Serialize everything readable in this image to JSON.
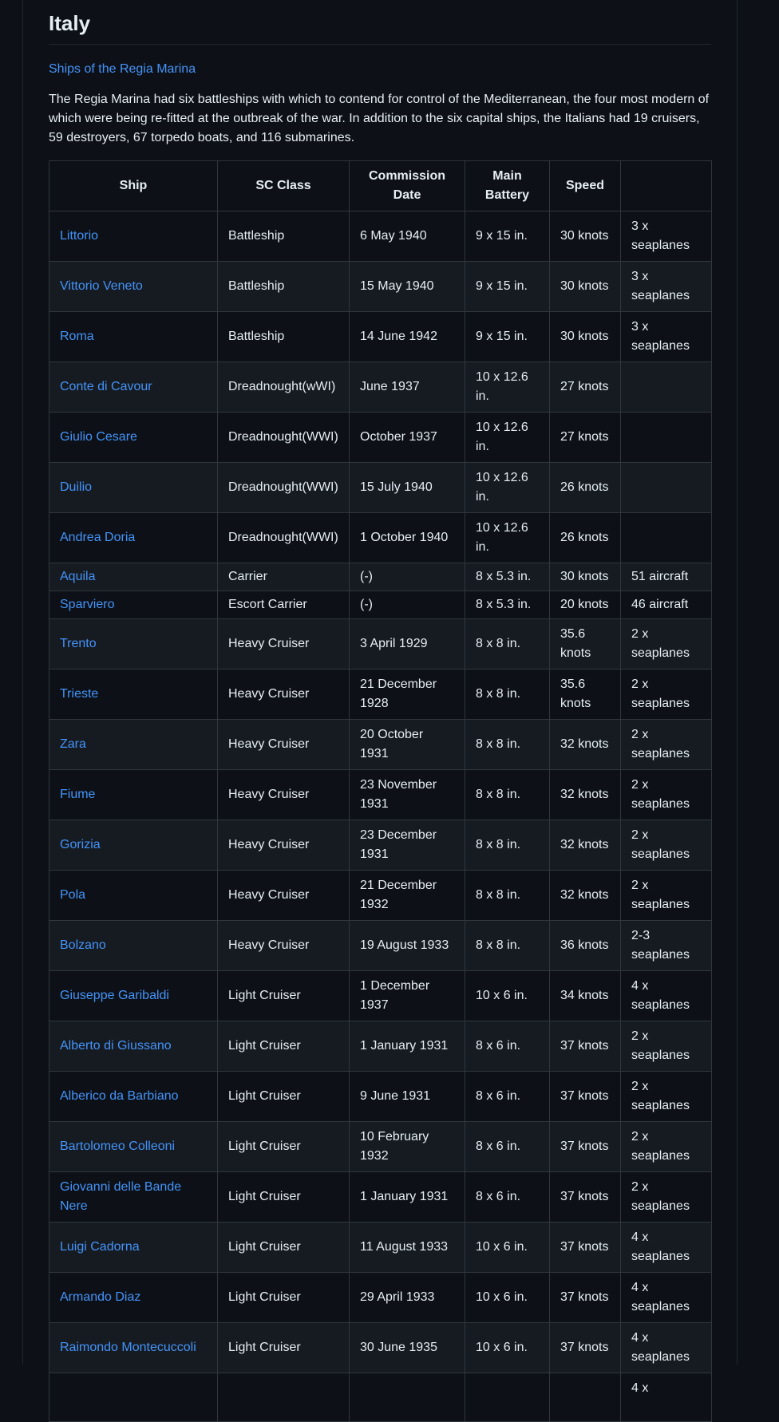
{
  "section_title": "Italy",
  "subheading_link": "Ships of the Regia Marina",
  "intro": "The Regia Marina had six battleships with which to contend for control of the Mediterranean, the four most modern of which were being re-fitted at the outbreak of the war. In addition to the six capital ships, the Italians had 19 cruisers, 59 destroyers, 67 torpedo boats, and 116 submarines.",
  "table": {
    "headers": [
      "Ship",
      "SC Class",
      "Commission Date",
      "Main Battery",
      "Speed",
      ""
    ],
    "rows": [
      [
        "Littorio",
        "Battleship",
        "6 May 1940",
        "9 x 15 in.",
        "30 knots",
        "3 x seaplanes"
      ],
      [
        "Vittorio Veneto",
        "Battleship",
        "15 May 1940",
        "9 x 15 in.",
        "30 knots",
        "3 x seaplanes"
      ],
      [
        "Roma",
        "Battleship",
        "14 June 1942",
        "9 x 15 in.",
        "30 knots",
        "3 x seaplanes"
      ],
      [
        "Conte di Cavour",
        "Dreadnought(wWI)",
        "June 1937",
        "10 x 12.6 in.",
        "27 knots",
        ""
      ],
      [
        "Giulio Cesare",
        "Dreadnought(WWI)",
        "October 1937",
        "10 x 12.6 in.",
        "27 knots",
        ""
      ],
      [
        "Duilio",
        "Dreadnought(WWI)",
        "15 July 1940",
        "10 x 12.6 in.",
        "26 knots",
        ""
      ],
      [
        "Andrea Doria",
        "Dreadnought(WWI)",
        "1 October 1940",
        "10 x 12.6 in.",
        "26 knots",
        ""
      ],
      [
        "Aquila",
        "Carrier",
        "(-)",
        "8 x 5.3 in.",
        "30 knots",
        "51 aircraft"
      ],
      [
        "Sparviero",
        "Escort Carrier",
        "(-)",
        "8 x 5.3 in.",
        "20 knots",
        "46 aircraft"
      ],
      [
        "Trento",
        "Heavy Cruiser",
        "3 April 1929",
        "8 x 8 in.",
        "35.6 knots",
        "2 x seaplanes"
      ],
      [
        "Trieste",
        "Heavy Cruiser",
        "21 December 1928",
        "8 x 8 in.",
        "35.6 knots",
        "2 x seaplanes"
      ],
      [
        "Zara",
        "Heavy Cruiser",
        "20 October 1931",
        "8 x 8 in.",
        "32 knots",
        "2 x seaplanes"
      ],
      [
        "Fiume",
        "Heavy Cruiser",
        "23 November 1931",
        "8 x 8 in.",
        "32 knots",
        "2 x seaplanes"
      ],
      [
        "Gorizia",
        "Heavy Cruiser",
        "23 December 1931",
        "8 x 8 in.",
        "32 knots",
        "2 x seaplanes"
      ],
      [
        "Pola",
        "Heavy Cruiser",
        "21 December 1932",
        "8 x 8 in.",
        "32 knots",
        "2 x seaplanes"
      ],
      [
        "Bolzano",
        "Heavy Cruiser",
        "19 August 1933",
        "8 x 8 in.",
        "36 knots",
        "2-3 seaplanes"
      ],
      [
        "Giuseppe Garibaldi",
        "Light Cruiser",
        "1 December 1937",
        "10 x 6 in.",
        "34 knots",
        "4 x seaplanes"
      ],
      [
        "Alberto di Giussano",
        "Light Cruiser",
        "1 January 1931",
        "8 x 6 in.",
        "37 knots",
        "2 x seaplanes"
      ],
      [
        "Alberico da Barbiano",
        "Light Cruiser",
        "9 June 1931",
        "8 x 6 in.",
        "37 knots",
        "2 x seaplanes"
      ],
      [
        "Bartolomeo Colleoni",
        "Light Cruiser",
        "10 February 1932",
        "8 x 6 in.",
        "37 knots",
        "2 x seaplanes"
      ],
      [
        "Giovanni delle Bande Nere",
        "Light Cruiser",
        "1 January 1931",
        "8 x 6 in.",
        "37 knots",
        "2 x seaplanes"
      ],
      [
        "Luigi Cadorna",
        "Light Cruiser",
        "11 August 1933",
        "10 x 6 in.",
        "37 knots",
        "4 x seaplanes"
      ],
      [
        "Armando Diaz",
        "Light Cruiser",
        "29 April 1933",
        "10 x 6 in.",
        "37 knots",
        "4 x seaplanes"
      ],
      [
        "Raimondo Montecuccoli",
        "Light Cruiser",
        "30 June 1935",
        "10 x 6 in.",
        "37 knots",
        "4 x seaplanes"
      ],
      [
        "",
        "",
        "",
        "",
        "",
        "4 x"
      ]
    ]
  }
}
